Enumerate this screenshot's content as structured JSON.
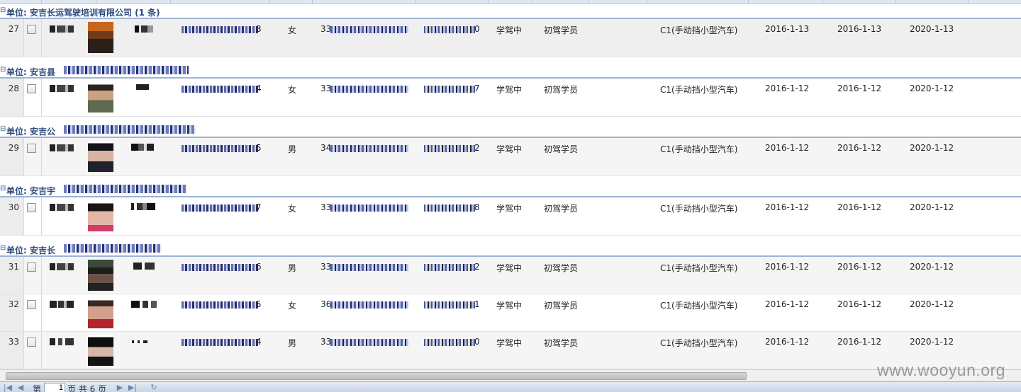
{
  "groups": [
    {
      "label": "单位: 安吉长运驾驶培训有限公司 (1 条)"
    },
    {
      "label": "单位: 安吉县"
    },
    {
      "label": "单位: 安吉公"
    },
    {
      "label": "单位: 安吉宇"
    },
    {
      "label": "单位: 安吉长"
    }
  ],
  "rows": [
    {
      "num": "27",
      "id_tail": "3",
      "gender": "女",
      "cert_prefix": "33",
      "phone_tail": "0",
      "status": "学驾中",
      "type": "初驾学员",
      "vehicle": "C1(手动挡小型汽车)",
      "date1": "2016-1-13",
      "date2": "2016-1-13",
      "date3": "2020-1-13"
    },
    {
      "num": "28",
      "id_tail": "4",
      "gender": "女",
      "cert_prefix": "33",
      "phone_tail": "7",
      "status": "学驾中",
      "type": "初驾学员",
      "vehicle": "C1(手动挡小型汽车)",
      "date1": "2016-1-12",
      "date2": "2016-1-12",
      "date3": "2020-1-12"
    },
    {
      "num": "29",
      "id_tail": "5",
      "gender": "男",
      "cert_prefix": "34",
      "phone_tail": "2",
      "status": "学驾中",
      "type": "初驾学员",
      "vehicle": "C1(手动挡小型汽车)",
      "date1": "2016-1-12",
      "date2": "2016-1-12",
      "date3": "2020-1-12"
    },
    {
      "num": "30",
      "id_tail": "7",
      "gender": "女",
      "cert_prefix": "33",
      "phone_tail": "8",
      "status": "学驾中",
      "type": "初驾学员",
      "vehicle": "C1(手动挡小型汽车)",
      "date1": "2016-1-12",
      "date2": "2016-1-12",
      "date3": "2020-1-12"
    },
    {
      "num": "31",
      "id_tail": "6",
      "gender": "男",
      "cert_prefix": "33",
      "phone_tail": "2",
      "status": "学驾中",
      "type": "初驾学员",
      "vehicle": "C1(手动挡小型汽车)",
      "date1": "2016-1-12",
      "date2": "2016-1-12",
      "date3": "2020-1-12"
    },
    {
      "num": "32",
      "id_tail": "5",
      "gender": "女",
      "cert_prefix": "36",
      "phone_tail": "1",
      "status": "学驾中",
      "type": "初驾学员",
      "vehicle": "C1(手动挡小型汽车)",
      "date1": "2016-1-12",
      "date2": "2016-1-12",
      "date3": "2020-1-12"
    },
    {
      "num": "33",
      "id_tail": "4",
      "gender": "男",
      "cert_prefix": "33",
      "phone_tail": "0",
      "status": "学驾中",
      "type": "初驾学员",
      "vehicle": "C1(手动挡小型汽车)",
      "date1": "2016-1-12",
      "date2": "2016-1-12",
      "date3": "2020-1-12"
    }
  ],
  "pager": {
    "prefix": "第",
    "page": "1",
    "suffix": "页 共 6 页"
  },
  "watermark": "www.wooyun.org",
  "colors": {
    "group_text": "#2c4a7c",
    "group_border": "#9db3d4",
    "pager_bg": "#c9d6e6"
  },
  "icons": {
    "first": "first-page-icon",
    "prev": "prev-page-icon",
    "next": "next-page-icon",
    "last": "last-page-icon",
    "refresh": "refresh-icon",
    "collapse": "collapse-group-icon"
  }
}
